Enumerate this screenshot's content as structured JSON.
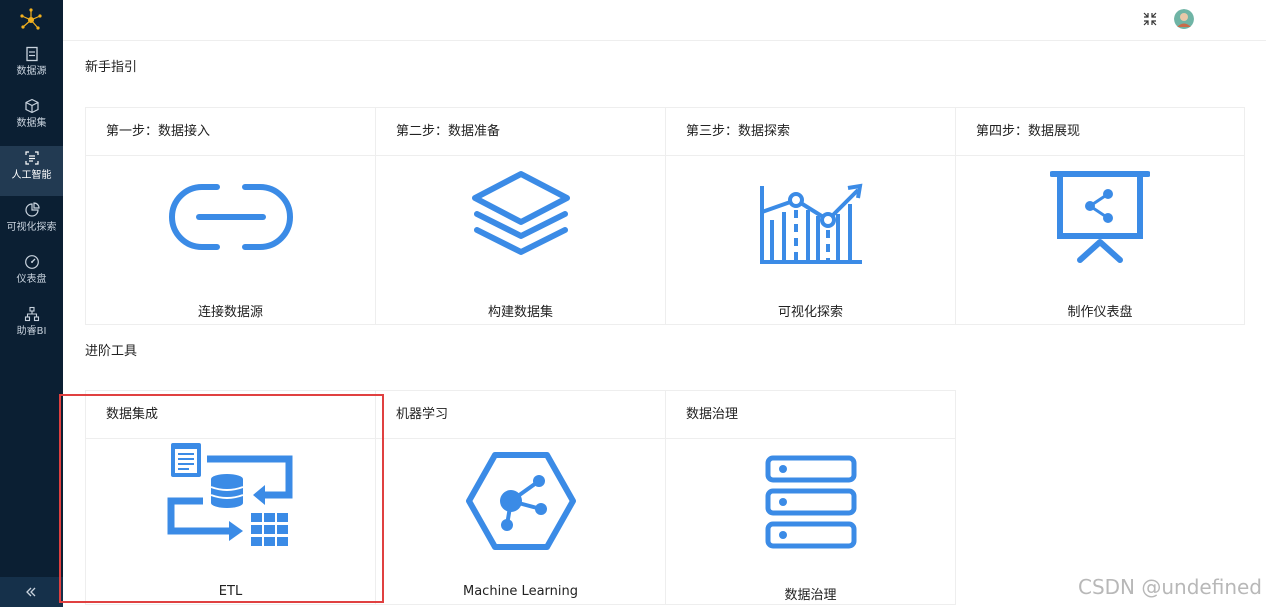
{
  "sidebar": {
    "items": [
      {
        "label": "数据源",
        "icon": "database-list-icon"
      },
      {
        "label": "数据集",
        "icon": "cube-icon"
      },
      {
        "label": "人工智能",
        "icon": "ai-scan-icon"
      },
      {
        "label": "可视化探索",
        "icon": "pie-chart-icon"
      },
      {
        "label": "仪表盘",
        "icon": "gauge-icon"
      },
      {
        "label": "助睿BI",
        "icon": "org-tree-icon"
      }
    ],
    "active_index": 2,
    "collapse_icon": "double-chevron-left-icon"
  },
  "topbar": {
    "fullscreen_icon": "fullscreen-icon",
    "avatar": "user-avatar"
  },
  "guide": {
    "title": "新手指引",
    "cards": [
      {
        "head": "第一步：数据接入",
        "label": "连接数据源",
        "icon": "link-icon"
      },
      {
        "head": "第二步：数据准备",
        "label": "构建数据集",
        "icon": "layers-icon"
      },
      {
        "head": "第三步：数据探索",
        "label": "可视化探索",
        "icon": "line-chart-icon"
      },
      {
        "head": "第四步：数据展现",
        "label": "制作仪表盘",
        "icon": "presentation-board-icon"
      }
    ]
  },
  "advanced": {
    "title": "进阶工具",
    "cards": [
      {
        "head": "数据集成",
        "label": "ETL",
        "icon": "etl-icon"
      },
      {
        "head": "机器学习",
        "label": "Machine Learning",
        "icon": "hexagon-share-icon"
      },
      {
        "head": "数据治理",
        "label": "数据治理",
        "icon": "server-stack-icon"
      }
    ]
  },
  "watermark": "CSDN @undefined",
  "colors": {
    "sidebar": "#0b1f33",
    "sidebar_active": "#223a52",
    "icon_blue": "#3b8be6",
    "highlight": "#e04040"
  }
}
